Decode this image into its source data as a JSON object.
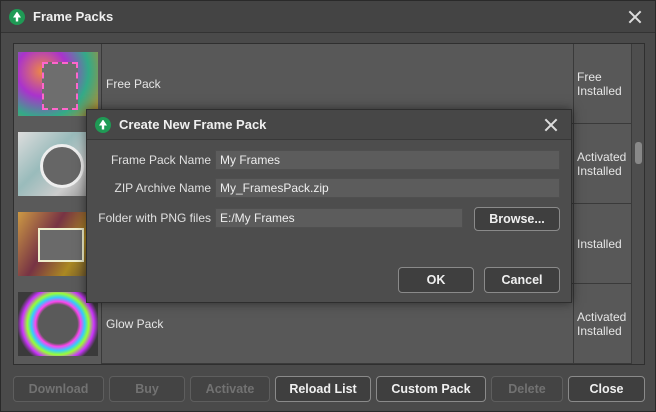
{
  "window": {
    "title": "Frame Packs"
  },
  "packs": [
    {
      "name": "Free Pack",
      "status": "Free Installed",
      "thumb": "pink-frame"
    },
    {
      "name": "",
      "status": "Activated Installed",
      "thumb": "oval-frame"
    },
    {
      "name": "",
      "status": "Installed",
      "thumb": "collage-frame"
    },
    {
      "name": "Glow Pack",
      "status": "Activated Installed",
      "thumb": "glow-ring-frame"
    }
  ],
  "dialog": {
    "title": "Create New Frame Pack",
    "fields": {
      "name_label": "Frame Pack Name",
      "name_value": "My Frames",
      "zip_label": "ZIP Archive Name",
      "zip_value": "My_FramesPack.zip",
      "folder_label": "Folder with PNG files",
      "folder_value": "E:/My Frames"
    },
    "browse_label": "Browse...",
    "ok_label": "OK",
    "cancel_label": "Cancel"
  },
  "toolbar": {
    "download": "Download",
    "buy": "Buy",
    "activate": "Activate",
    "reload": "Reload List",
    "custom": "Custom Pack",
    "delete": "Delete",
    "close": "Close"
  },
  "colors": {
    "accent": "#1f9a55",
    "window_bg": "#4a4a4a",
    "list_bg": "#585858"
  }
}
